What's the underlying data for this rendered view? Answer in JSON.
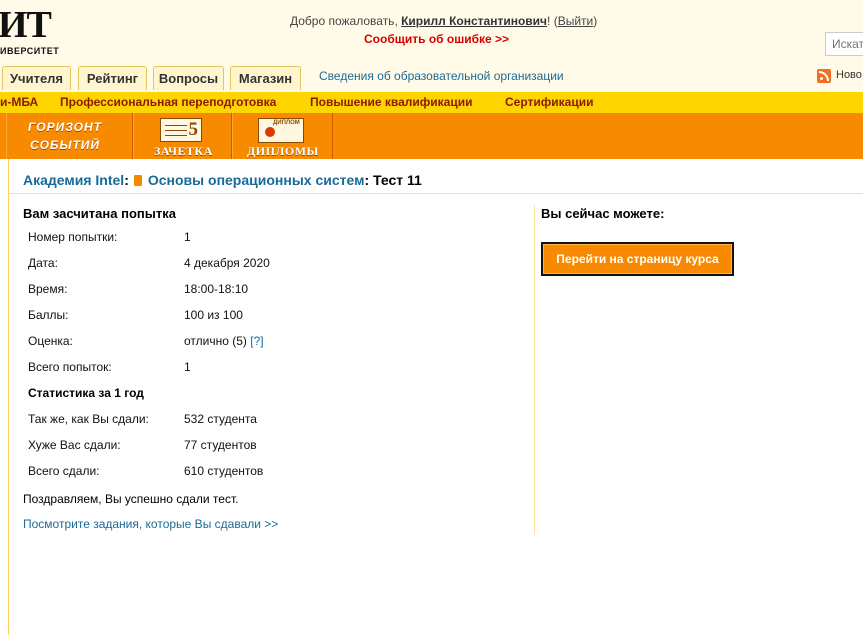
{
  "header": {
    "logo_text": "ИТ",
    "logo_subtitle": "ИВЕРСИТЕТ",
    "welcome_prefix": "Добро пожаловать, ",
    "user_name": "Кирилл Константинович",
    "welcome_suffix": "! (",
    "logout": "Выйти",
    "close_paren": ")",
    "report_error": "Сообщить об ошибке >>",
    "search_placeholder": "Искать"
  },
  "tabs": [
    "Учителя",
    "Рейтинг",
    "Вопросы",
    "Магазин"
  ],
  "org_info_link": "Сведения об образовательной организации",
  "news_label": "Ново",
  "programs": [
    "и-МБА",
    "Профессиональная переподготовка",
    "Повышение квалификации",
    "Сертификации"
  ],
  "banner": {
    "horizon_line1": "ГОРИЗОНТ",
    "horizon_line2": "СОБЫТИЙ",
    "gradebook_number": "5",
    "gradebook_label": "ЗАЧЕТКА",
    "diploma_icon_text": "ДИПЛОМ",
    "diploma_label": "ДИПЛОМЫ"
  },
  "breadcrumb": {
    "academy": "Академия Intel",
    "sep1": ":",
    "course": "Основы операционных систем",
    "sep2": ": ",
    "test": "Тест 11"
  },
  "result": {
    "heading": "Вам засчитана попытка",
    "rows": [
      {
        "label": "Номер попытки:",
        "value": "1"
      },
      {
        "label": "Дата:",
        "value": "4 декабря 2020"
      },
      {
        "label": "Время:",
        "value": "18:00-18:10"
      },
      {
        "label": "Баллы:",
        "value": "100 из 100"
      },
      {
        "label": "Оценка:",
        "value": "отлично (5)",
        "help": "[?]"
      },
      {
        "label": "Всего попыток:",
        "value": "1"
      }
    ],
    "stats_heading": "Статистика за 1 год",
    "stats": [
      {
        "label": "Так же, как Вы сдали:",
        "value": "532 студента"
      },
      {
        "label": "Хуже Вас сдали:",
        "value": "77 студентов"
      },
      {
        "label": "Всего сдали:",
        "value": "610 студентов"
      }
    ],
    "congrats": "Поздравляем, Вы успешно сдали тест.",
    "see_tasks_link": "Посмотрите задания, которые Вы сдавали >>"
  },
  "actions": {
    "heading": "Вы сейчас можете:",
    "go_to_course": "Перейти на страницу курса"
  },
  "colors": {
    "accent_orange": "#f88a00",
    "programs_yellow": "#ffd500",
    "link_blue": "#1a6a99",
    "error_red": "#d40000"
  }
}
